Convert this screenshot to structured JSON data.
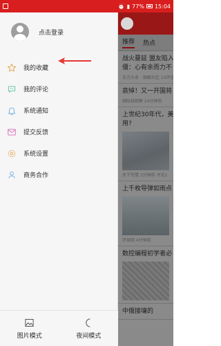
{
  "statusbar": {
    "battery": "77%",
    "time": "15:04"
  },
  "drawer": {
    "profile": {
      "label": "点击登录",
      "avatar_icon": "avatar-icon"
    },
    "menu": [
      {
        "label": "我的收藏",
        "icon": "star-icon",
        "color": "#e0a84a"
      },
      {
        "label": "我的评论",
        "icon": "comment-icon",
        "color": "#5cc39a"
      },
      {
        "label": "系统通知",
        "icon": "bell-icon",
        "color": "#6aaee8"
      },
      {
        "label": "提交反馈",
        "icon": "feedback-icon",
        "color": "#d36ab4"
      },
      {
        "label": "系统设置",
        "icon": "gear-icon",
        "color": "#e3a64b"
      },
      {
        "label": "商务合作",
        "icon": "person-icon",
        "color": "#6aaee8"
      }
    ],
    "bottom": [
      {
        "label": "图片模式",
        "icon": "image-icon"
      },
      {
        "label": "夜间模式",
        "icon": "moon-icon"
      }
    ]
  },
  "background_app": {
    "tabs": [
      "推荐",
      "热点"
    ],
    "articles": [
      {
        "title": "战火蔓延 盟友陷入",
        "subtitle": "僵：心有余而力不",
        "meta": "东方头条 · 强眼社区 10评论"
      },
      {
        "title": "哀悼！又一开国将",
        "meta": "国际线观察 24分钟前"
      },
      {
        "title": "上世纪30年代，美",
        "subtitle": "用?",
        "meta": ""
      },
      {
        "title": "上千枚导弹如雨点",
        "meta": "环球网 4分钟前"
      },
      {
        "title": "数控编程初学者必",
        "meta": ""
      },
      {
        "title": "中俄接壤的",
        "meta": ""
      }
    ],
    "meta_extra": "天下军情 3分钟前 评论1"
  },
  "colors": {
    "accent_red": "#d81e1e",
    "arrow_red": "#e53935"
  }
}
